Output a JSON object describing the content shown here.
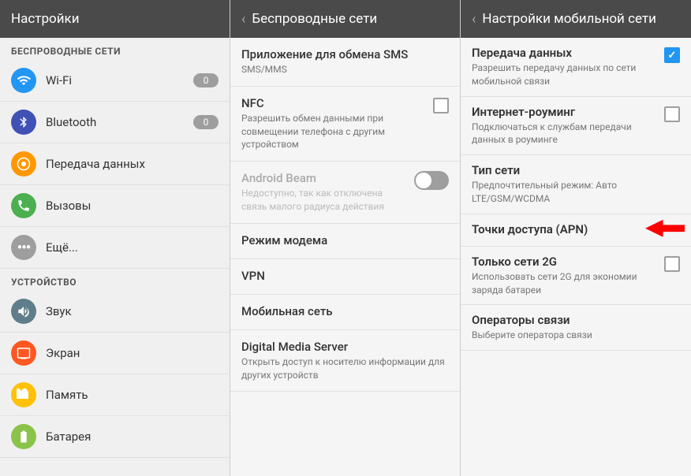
{
  "left_panel": {
    "header": "Настройки",
    "sections": [
      {
        "label": "БЕСПРОВОДНЫЕ СЕТИ",
        "items": [
          {
            "id": "wifi",
            "icon": "wifi",
            "text": "Wi-Fi",
            "badge": "0",
            "icon_char": "📶",
            "icon_bg": "wifi"
          },
          {
            "id": "bluetooth",
            "icon": "bt",
            "text": "Bluetooth",
            "badge": "0",
            "icon_char": "B",
            "icon_bg": "bt"
          },
          {
            "id": "data",
            "icon": "data",
            "text": "Передача данных",
            "badge": "",
            "icon_char": "⊙",
            "icon_bg": "data"
          },
          {
            "id": "calls",
            "icon": "calls",
            "text": "Вызовы",
            "badge": "",
            "icon_char": "📞",
            "icon_bg": "calls"
          },
          {
            "id": "more",
            "icon": "more",
            "text": "Ещё...",
            "badge": "",
            "icon_char": "⋯",
            "icon_bg": "more",
            "has_arrow": true
          }
        ]
      },
      {
        "label": "УСТРОЙСТВО",
        "items": [
          {
            "id": "sound",
            "icon": "sound",
            "text": "Звук",
            "icon_char": "🔊",
            "icon_bg": "sound"
          },
          {
            "id": "display",
            "icon": "display",
            "text": "Экран",
            "icon_char": "📱",
            "icon_bg": "display"
          },
          {
            "id": "storage",
            "icon": "storage",
            "text": "Память",
            "icon_char": "💾",
            "icon_bg": "storage"
          },
          {
            "id": "battery",
            "icon": "battery",
            "text": "Батарея",
            "icon_char": "🔋",
            "icon_bg": "battery"
          }
        ]
      }
    ]
  },
  "middle_panel": {
    "header": "Беспроводные сети",
    "back_arrow": "‹",
    "items": [
      {
        "id": "sms",
        "title": "Приложение для обмена SMS",
        "subtitle": "SMS/MMS",
        "has_checkbox": false,
        "disabled": false
      },
      {
        "id": "nfc",
        "title": "NFC",
        "subtitle": "Разрешить обмен данными при совмещении телефона с другим устройством",
        "has_checkbox": true,
        "checked": false,
        "disabled": false
      },
      {
        "id": "android_beam",
        "title": "Android Beam",
        "subtitle": "Недоступно, так как отключена связь малого радиуса действия",
        "has_toggle": true,
        "disabled": true
      },
      {
        "id": "hotspot",
        "title": "Режим модема",
        "subtitle": "",
        "has_arrow": true,
        "disabled": false
      },
      {
        "id": "vpn",
        "title": "VPN",
        "subtitle": "",
        "disabled": false
      },
      {
        "id": "mobile_network",
        "title": "Мобильная сеть",
        "subtitle": "",
        "has_arrow": true,
        "disabled": false
      },
      {
        "id": "dms",
        "title": "Digital Media Server",
        "subtitle": "Открыть доступ к носителю информации для других устройств",
        "disabled": false
      }
    ]
  },
  "right_panel": {
    "header": "Настройки мобильной сети",
    "back_arrow": "‹",
    "items": [
      {
        "id": "data_transfer",
        "title": "Передача данных",
        "subtitle": "Разрешить передачу данных по сети мобильной связи",
        "has_checkbox": true,
        "checked": true
      },
      {
        "id": "roaming",
        "title": "Интернет-роуминг",
        "subtitle": "Подключаться к службам передачи данных в роуминге",
        "has_checkbox": true,
        "checked": false
      },
      {
        "id": "network_type",
        "title": "Тип сети",
        "subtitle": "Предпочтительный режим: Авто LTE/GSM/WCDMA",
        "has_checkbox": false
      },
      {
        "id": "apn",
        "title": "Точки доступа (APN)",
        "subtitle": "",
        "has_arrow": true,
        "has_checkbox": false
      },
      {
        "id": "2g_only",
        "title": "Только сети 2G",
        "subtitle": "Использовать сети 2G для экономии заряда батареи",
        "has_checkbox": true,
        "checked": false
      },
      {
        "id": "operators",
        "title": "Операторы связи",
        "subtitle": "Выберите оператора связи",
        "has_checkbox": false
      }
    ]
  }
}
